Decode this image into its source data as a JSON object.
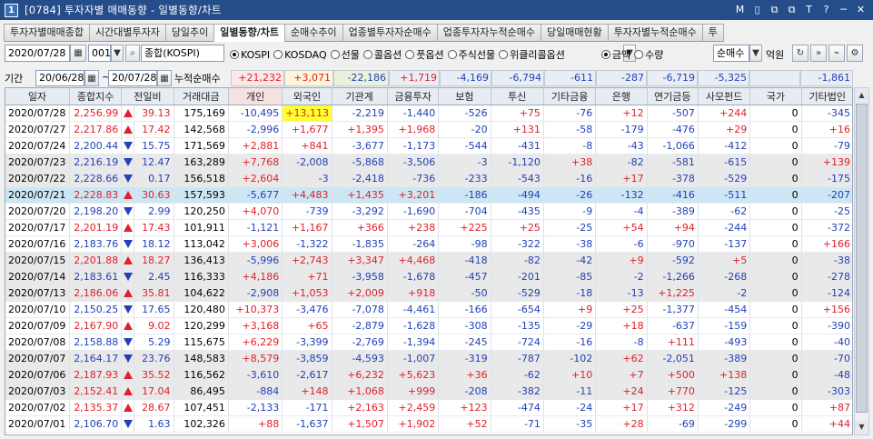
{
  "window": {
    "number": "1",
    "title": "[0784] 투자자별 매매동향 - 일별동향/차트",
    "controls": [
      "M",
      "▯",
      "⧉",
      "⧉",
      "T",
      "?",
      "─",
      "✕"
    ]
  },
  "tabs": [
    "투자자별매매종합",
    "시간대별투자자",
    "당일추이",
    "일별동향/차트",
    "순매수추이",
    "업종별투자자순매수",
    "업종투자자누적순매수",
    "당일매매현황",
    "투자자별누적순매수",
    "투"
  ],
  "toolbar": {
    "date": "2020/07/28",
    "code": "001",
    "index_name": "종합(KOSPI)",
    "market_options": [
      {
        "label": "KOSPI",
        "selected": true
      },
      {
        "label": "KOSDAQ",
        "selected": false
      },
      {
        "label": "선물",
        "selected": false
      },
      {
        "label": "콜옵션",
        "selected": false
      },
      {
        "label": "풋옵션",
        "selected": false
      },
      {
        "label": "주식선물",
        "selected": false
      },
      {
        "label": "위클리콜옵션",
        "selected": false
      }
    ],
    "unit_options": [
      {
        "label": "금액",
        "selected": true
      },
      {
        "label": "수량",
        "selected": false
      }
    ],
    "view_select": "순매수",
    "unit_label": "억원"
  },
  "period": {
    "label": "기간",
    "from": "20/06/28",
    "to": "20/07/28",
    "cum_label": "누적순매수",
    "cum_values": [
      "+21,232",
      "+3,071",
      "-22,186",
      "+1,719",
      "-4,169",
      "-6,794",
      "-611",
      "-287",
      "-6,719",
      "-5,325",
      "",
      "-1,861"
    ]
  },
  "grid": {
    "headers": [
      "일자",
      "종합지수",
      "전일비",
      "거래대금",
      "개인",
      "외국인",
      "기관계",
      "금융투자",
      "보험",
      "투신",
      "기타금융",
      "은행",
      "연기금등",
      "사모펀드",
      "국가",
      "기타법인"
    ],
    "rows": [
      [
        "2020/07/28",
        "2,256.99",
        "up",
        "39.13",
        "175,169",
        "-10,495",
        "+13,113",
        "-2,219",
        "-1,440",
        "-526",
        "+75",
        "-76",
        "+12",
        "-507",
        "+244",
        "0",
        "-345"
      ],
      [
        "2020/07/27",
        "2,217.86",
        "up",
        "17.42",
        "142,568",
        "-2,996",
        "+1,677",
        "+1,395",
        "+1,968",
        "-20",
        "+131",
        "-58",
        "-179",
        "-476",
        "+29",
        "0",
        "+16"
      ],
      [
        "2020/07/24",
        "2,200.44",
        "dn",
        "15.75",
        "171,569",
        "+2,881",
        "+841",
        "-3,677",
        "-1,173",
        "-544",
        "-431",
        "-8",
        "-43",
        "-1,066",
        "-412",
        "0",
        "-79"
      ],
      [
        "2020/07/23",
        "2,216.19",
        "dn",
        "12.47",
        "163,289",
        "+7,768",
        "-2,008",
        "-5,868",
        "-3,506",
        "-3",
        "-1,120",
        "+38",
        "-82",
        "-581",
        "-615",
        "0",
        "+139"
      ],
      [
        "2020/07/22",
        "2,228.66",
        "dn",
        "0.17",
        "156,518",
        "+2,604",
        "-3",
        "-2,418",
        "-736",
        "-233",
        "-543",
        "-16",
        "+17",
        "-378",
        "-529",
        "0",
        "-175"
      ],
      [
        "2020/07/21",
        "2,228.83",
        "up",
        "30.63",
        "157,593",
        "-5,677",
        "+4,483",
        "+1,435",
        "+3,201",
        "-186",
        "-494",
        "-26",
        "-132",
        "-416",
        "-511",
        "0",
        "-207"
      ],
      [
        "2020/07/20",
        "2,198.20",
        "dn",
        "2.99",
        "120,250",
        "+4,070",
        "-739",
        "-3,292",
        "-1,690",
        "-704",
        "-435",
        "-9",
        "-4",
        "-389",
        "-62",
        "0",
        "-25"
      ],
      [
        "2020/07/17",
        "2,201.19",
        "up",
        "17.43",
        "101,911",
        "-1,121",
        "+1,167",
        "+366",
        "+238",
        "+225",
        "+25",
        "-25",
        "+54",
        "+94",
        "-244",
        "0",
        "-372"
      ],
      [
        "2020/07/16",
        "2,183.76",
        "dn",
        "18.12",
        "113,042",
        "+3,006",
        "-1,322",
        "-1,835",
        "-264",
        "-98",
        "-322",
        "-38",
        "-6",
        "-970",
        "-137",
        "0",
        "+166"
      ],
      [
        "2020/07/15",
        "2,201.88",
        "up",
        "18.27",
        "136,413",
        "-5,996",
        "+2,743",
        "+3,347",
        "+4,468",
        "-418",
        "-82",
        "-42",
        "+9",
        "-592",
        "+5",
        "0",
        "-38"
      ],
      [
        "2020/07/14",
        "2,183.61",
        "dn",
        "2.45",
        "116,333",
        "+4,186",
        "+71",
        "-3,958",
        "-1,678",
        "-457",
        "-201",
        "-85",
        "-2",
        "-1,266",
        "-268",
        "0",
        "-278"
      ],
      [
        "2020/07/13",
        "2,186.06",
        "up",
        "35.81",
        "104,622",
        "-2,908",
        "+1,053",
        "+2,009",
        "+918",
        "-50",
        "-529",
        "-18",
        "-13",
        "+1,225",
        "-2",
        "0",
        "-124"
      ],
      [
        "2020/07/10",
        "2,150.25",
        "dn",
        "17.65",
        "120,480",
        "+10,373",
        "-3,476",
        "-7,078",
        "-4,461",
        "-166",
        "-654",
        "+9",
        "+25",
        "-1,377",
        "-454",
        "0",
        "+156"
      ],
      [
        "2020/07/09",
        "2,167.90",
        "up",
        "9.02",
        "120,299",
        "+3,168",
        "+65",
        "-2,879",
        "-1,628",
        "-308",
        "-135",
        "-29",
        "+18",
        "-637",
        "-159",
        "0",
        "-390"
      ],
      [
        "2020/07/08",
        "2,158.88",
        "dn",
        "5.29",
        "115,675",
        "+6,229",
        "-3,399",
        "-2,769",
        "-1,394",
        "-245",
        "-724",
        "-16",
        "-8",
        "+111",
        "-493",
        "0",
        "-40"
      ],
      [
        "2020/07/07",
        "2,164.17",
        "dn",
        "23.76",
        "148,583",
        "+8,579",
        "-3,859",
        "-4,593",
        "-1,007",
        "-319",
        "-787",
        "-102",
        "+62",
        "-2,051",
        "-389",
        "0",
        "-70"
      ],
      [
        "2020/07/06",
        "2,187.93",
        "up",
        "35.52",
        "116,562",
        "-3,610",
        "-2,617",
        "+6,232",
        "+5,623",
        "+36",
        "-62",
        "+10",
        "+7",
        "+500",
        "+138",
        "0",
        "-48"
      ],
      [
        "2020/07/03",
        "2,152.41",
        "up",
        "17.04",
        "86,495",
        "-884",
        "+148",
        "+1,068",
        "+999",
        "-208",
        "-382",
        "-11",
        "+24",
        "+770",
        "-125",
        "0",
        "-303"
      ],
      [
        "2020/07/02",
        "2,135.37",
        "up",
        "28.67",
        "107,451",
        "-2,133",
        "-171",
        "+2,163",
        "+2,459",
        "+123",
        "-474",
        "-24",
        "+17",
        "+312",
        "-249",
        "0",
        "+87"
      ],
      [
        "2020/07/01",
        "2,106.70",
        "dn",
        "1.63",
        "102,326",
        "+88",
        "-1,637",
        "+1,507",
        "+1,902",
        "+52",
        "-71",
        "-35",
        "+28",
        "-69",
        "-299",
        "0",
        "+44"
      ]
    ]
  },
  "colors": {
    "up": "#e0202a",
    "down": "#2141b8",
    "highlight": "#ffff33",
    "selected_row": "#cde6f4",
    "titlebar": "#254d8a"
  }
}
